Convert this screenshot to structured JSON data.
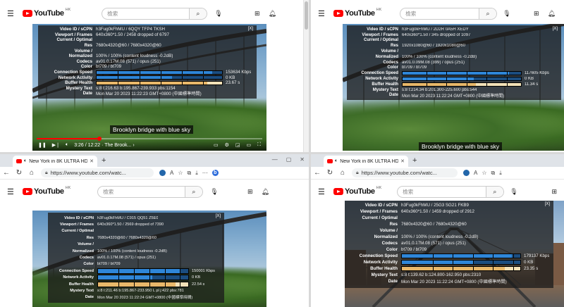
{
  "youtube": {
    "logo_text": "YouTube",
    "region": "HK",
    "search_placeholder": "檢索"
  },
  "browser": {
    "tab_title": "New York in 8K ULTRA HD",
    "url": "https://www.youtube.com/watc...",
    "url_short": "https://www.youtube.com/watc..."
  },
  "stats_labels": [
    "Video ID / sCPN",
    "Viewport / Frames",
    "Current / Optimal",
    "Res",
    "Volume /",
    "Normalized",
    "Codecs",
    "Color",
    "Connection Speed",
    "Network Activity",
    "Buffer Health",
    "Mystery Text",
    "Date"
  ],
  "panels": [
    {
      "values": [
        "h3Fug0kFhMU / 6QQY TFP4 TKSH",
        "640x360*1.50 / 2458 dropped of 6797",
        "",
        "7680x4320@60 / 7680x4320@60",
        "",
        "100% / 100% (content loudness -0.2dB)",
        "av01.0.17M.08 (571) / opus (251)",
        "bt709 / bt709",
        "",
        "",
        "",
        "s:8 t:216.63 b:195.867-239.933 pbs:1154",
        "Mon Mar 20 2023 11:22:23 GMT+0800 (中國標準時間)"
      ],
      "connection_speed": "153634 Kbps",
      "network_activity": "0 KB",
      "buffer_health": "23.67 s",
      "conn_fill": 0.92,
      "buffer_fill": 0.88,
      "caption": "Brooklyn bridge with blue sky",
      "time": "3:26 / 12:22 · The Brook... ›",
      "progress": 0.28
    },
    {
      "values": [
        "h3Fug0kFhMU / 2D2R 0A5H XEDY",
        "640x360*1.50 / 345 dropped of 1097",
        "",
        "1920x1080@60 / 1920x1080@60",
        "",
        "100% / 100% (content loudness -0.2dB)",
        "av01.0.09M.08 (399) / opus (251)",
        "bt709 / bt709",
        "",
        "",
        "",
        "s:8 t:214.34 b:201.300-225.600 pbs:544",
        "Mon Mar 20 2023 11:22:24 GMT+0800 (中國標準時間)"
      ],
      "connection_speed": "117605 Kbps",
      "network_activity": "0 KB",
      "buffer_health": "11.34 s",
      "conn_fill": 0.9,
      "buffer_fill": 0.62,
      "caption": "Brooklyn bridge with blue sky"
    },
    {
      "values": [
        "h3Fug0kFhMU / C915 QQ51 Z5E0",
        "640x360*1.50 / 2569 dropped of 7390",
        "",
        "7680x4320@60 / 7680x4320@60",
        "",
        "100% / 100% (content loudness -0.2dB)",
        "av01.0.17M.08 (571) / opus (251)",
        "bt709 / bt709",
        "",
        "",
        "",
        "s:8 t:211.46 b:195.867-233.950 L pl j:422 pbs:781",
        "Mon Mar 20 2023 11:22:24 GMT+0800 (中國標準時間)"
      ],
      "connection_speed": "150001 Kbps",
      "network_activity": "0 KB",
      "buffer_health": "22.54 s",
      "conn_fill": 0.91,
      "buffer_fill": 0.86
    },
    {
      "values": [
        "h3Fug0kFhMU / 25G3 SG21 FKB9",
        "640x360*1.50 / 1459 dropped of 2912",
        "",
        "7680x4320@60 / 7680x4320@60",
        "",
        "100% / 100% (content loudness -0.2dB)",
        "av01.0.17M.08 (571) / opus (251)",
        "bt709 / bt709",
        "",
        "",
        "",
        "s:8 t:139.62 b:124.800-162.950 pbs:2310",
        "Mon Mar 20 2023 11:22:24 GMT+0800 (中國標準時間)"
      ],
      "connection_speed": "179137 Kbps",
      "network_activity": "0 KB",
      "buffer_health": "23.35 s",
      "conn_fill": 0.93,
      "buffer_fill": 0.87
    }
  ],
  "colors": {
    "conn_bar": "#2f86d8",
    "net_bar": "#2f86d8",
    "buffer_bar": "#e8b86a",
    "yt_red": "#ff0000"
  }
}
